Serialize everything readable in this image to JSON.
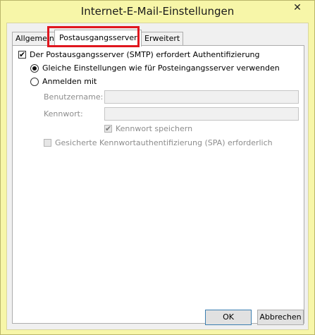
{
  "window": {
    "title": "Internet-E-Mail-Einstellungen",
    "close_symbol": "✕"
  },
  "tabs": [
    {
      "label": "Allgemein",
      "selected": false
    },
    {
      "label": "Postausgangsserver",
      "selected": true
    },
    {
      "label": "Erweitert",
      "selected": false
    }
  ],
  "outgoing": {
    "smtp_auth_label": "Der Postausgangsserver (SMTP) erfordert Authentifizierung",
    "smtp_auth_checked": "✔",
    "same_settings_label": "Gleiche Einstellungen wie für Posteingangsserver verwenden",
    "login_with_label": "Anmelden mit",
    "username_label": "Benutzername:",
    "username_value": "",
    "password_label": "Kennwort:",
    "password_value": "",
    "remember_password_label": "Kennwort speichern",
    "remember_password_checked": "✔",
    "spa_label": "Gesicherte Kennwortauthentifizierung (SPA) erforderlich"
  },
  "footer": {
    "ok_label": "OK",
    "cancel_label": "Abbrechen"
  },
  "colors": {
    "window_frame": "#f7f6a8",
    "highlight": "#e0161e",
    "dialog_bg": "#f0f0f0"
  }
}
